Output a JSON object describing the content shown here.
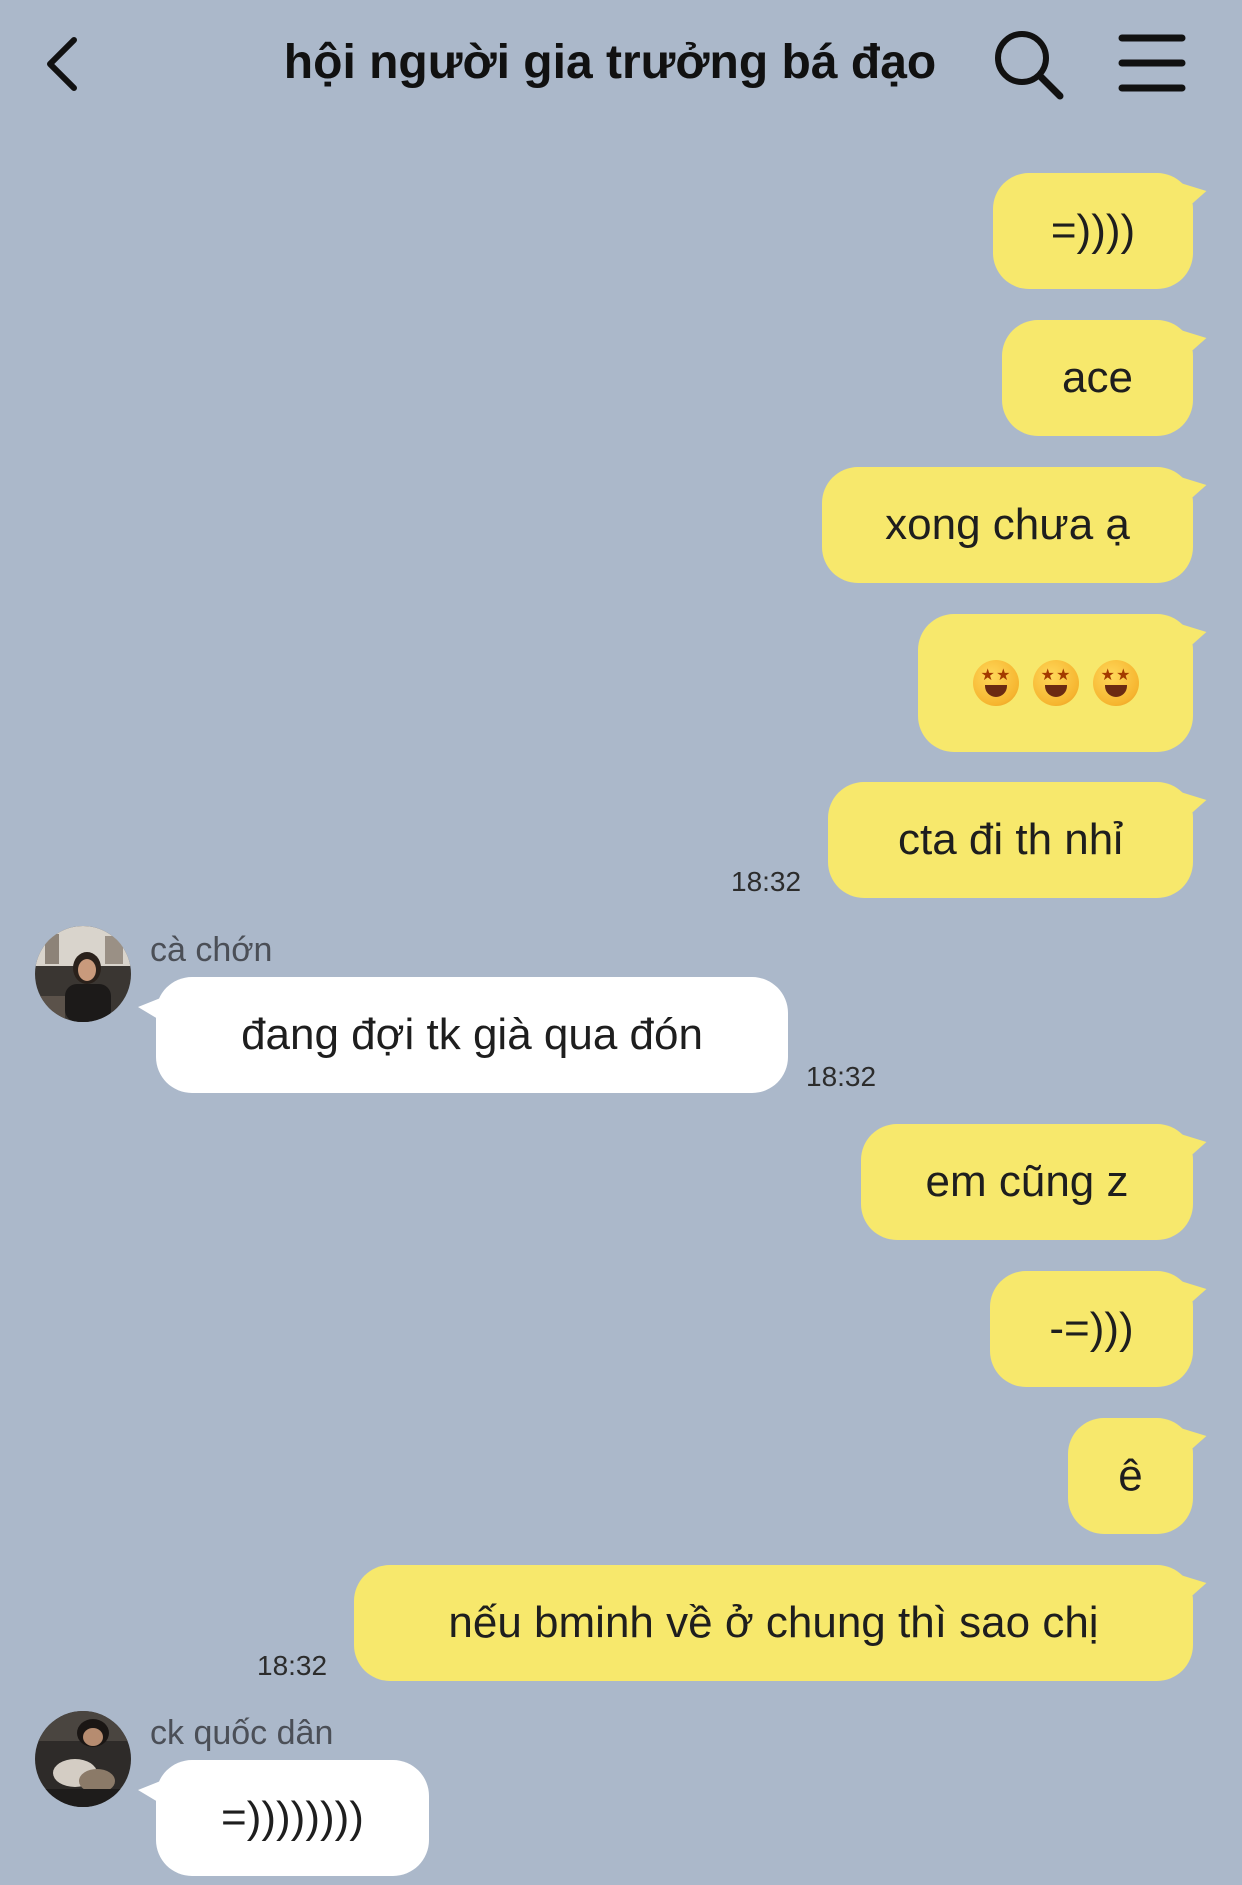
{
  "header": {
    "title": "hội người gia trưởng bá đạo",
    "back_icon": "chevron-left-icon",
    "search_icon": "search-icon",
    "menu_icon": "hamburger-menu-icon"
  },
  "messages": {
    "m1": "=))))",
    "m2": "ace",
    "m3": "xong chưa ạ",
    "m4": "🤩🤩🤩",
    "m5": "cta đi th nhỉ",
    "t1": "18:32",
    "s1": "cà chớn",
    "m6": "đang đợi tk già qua đón",
    "t2": "18:32",
    "m7": "em cũng z",
    "m8": "-=)))",
    "m9": "ê",
    "m10": "nếu bminh về ở chung thì sao chị",
    "t3": "18:32",
    "s2": "ck quốc dân",
    "m11": "=))))))))"
  },
  "colors": {
    "background": "#abb8ca",
    "outgoing_bubble": "#f7e86c",
    "incoming_bubble": "#ffffff"
  }
}
